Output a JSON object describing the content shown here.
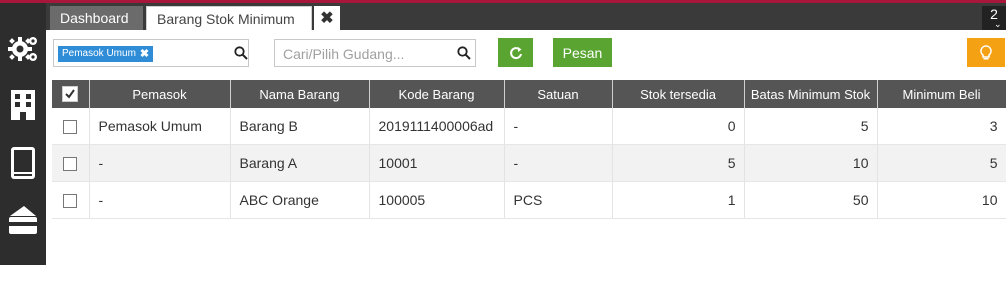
{
  "tabs": {
    "dashboard": "Dashboard",
    "active": "Barang Stok Minimum",
    "close_glyph": "✖",
    "counter": "2"
  },
  "sidebar": {
    "icons": [
      "gears-icon",
      "building-icon",
      "book-icon",
      "card-icon",
      "folder-icon"
    ]
  },
  "toolbar": {
    "filter_chip": "Pemasok Umum",
    "chip_remove": "✖",
    "warehouse_placeholder": "Cari/Pilih Gudang...",
    "pesan_label": "Pesan"
  },
  "colors": {
    "accent_green": "#5aa532",
    "chip_blue": "#2f8dd8",
    "bulb_orange": "#f4a114",
    "header_gray": "#555555",
    "sidebar_dark": "#2d2d2d",
    "top_line": "#a8163c"
  },
  "table": {
    "headers": [
      "Pemasok",
      "Nama Barang",
      "Kode Barang",
      "Satuan",
      "Stok tersedia",
      "Batas Minimum Stok",
      "Minimum Beli"
    ],
    "rows": [
      {
        "pemasok": "Pemasok Umum",
        "nama": "Barang B",
        "kode": "2019111400006ad",
        "satuan": "-",
        "stok": "0",
        "batas": "5",
        "min_beli": "3"
      },
      {
        "pemasok": "-",
        "nama": "Barang A",
        "kode": "10001",
        "satuan": "-",
        "stok": "5",
        "batas": "10",
        "min_beli": "5"
      },
      {
        "pemasok": "-",
        "nama": "ABC Orange",
        "kode": "100005",
        "satuan": "PCS",
        "stok": "1",
        "batas": "50",
        "min_beli": "10"
      }
    ]
  }
}
